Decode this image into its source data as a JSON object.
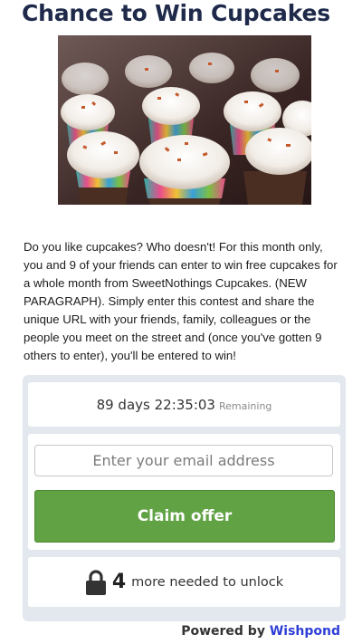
{
  "title": "Chance to Win Cupcakes",
  "hero_image": {
    "icon": "cupcakes-photo"
  },
  "description": "Do you like cupcakes? Who doesn't! For this month only, you and 9 of your friends can enter to win free cupcakes for a whole month from SweetNothings Cupcakes.  (NEW PARAGRAPH). Simply enter this contest and share the unique URL with your friends, family, colleagues or the people you meet on the street and (once you've gotten 9 others to enter), you'll be entered to win!",
  "timer": {
    "value": "89 days 22:35:03",
    "suffix": "Remaining"
  },
  "form": {
    "email_placeholder": "Enter your email address",
    "email_value": "",
    "claim_label": "Claim offer"
  },
  "unlock": {
    "icon": "lock-icon",
    "count": "4",
    "message": "more needed to unlock"
  },
  "footer": {
    "powered_by": "Powered by",
    "brand": "Wishpond"
  },
  "colors": {
    "title": "#1f2a4a",
    "claim_button": "#61a244",
    "widget_bg": "#e3e7ee",
    "brand_link": "#2f3fd6"
  }
}
